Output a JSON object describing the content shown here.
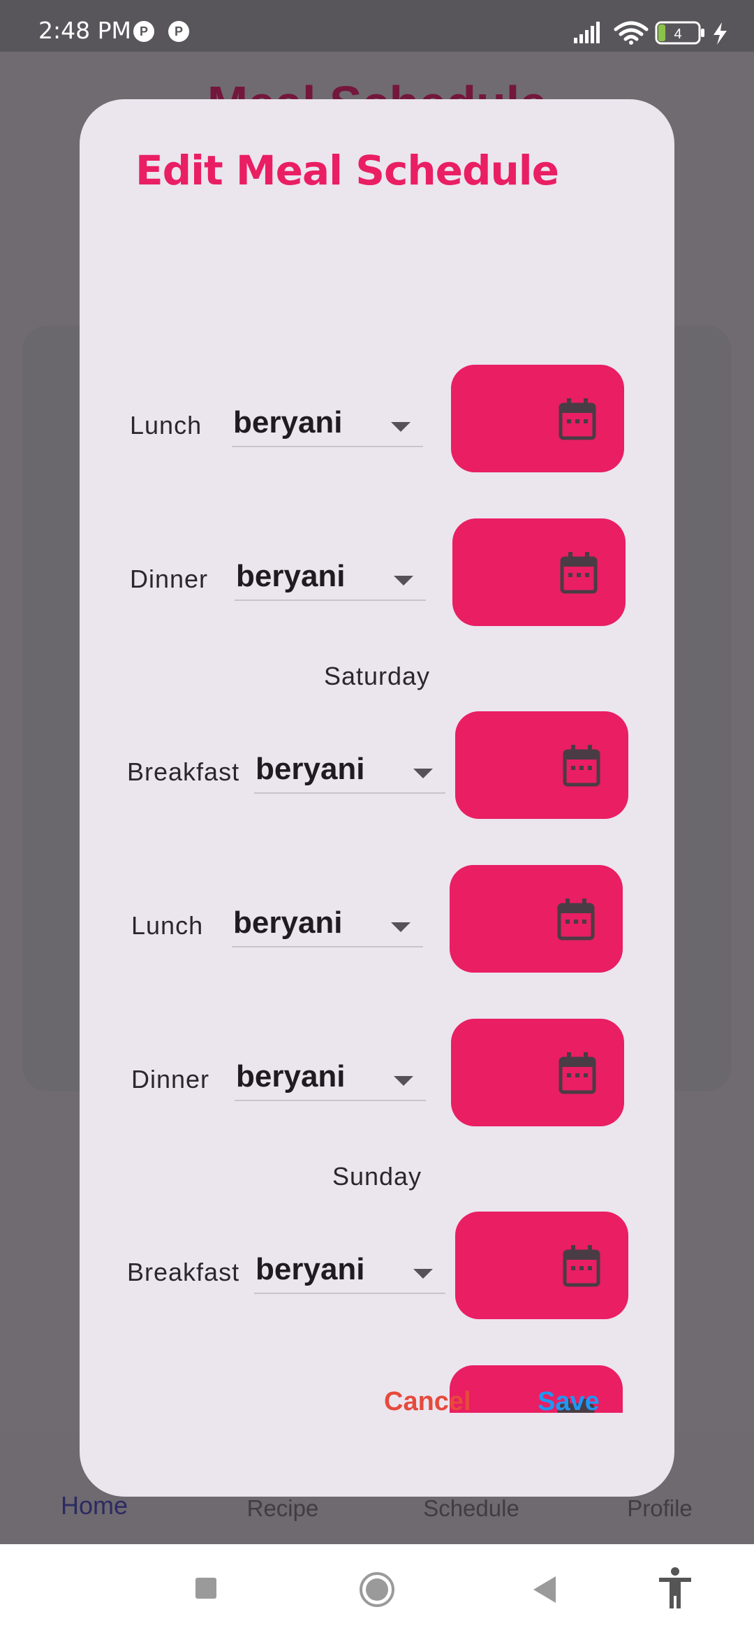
{
  "status_bar": {
    "time": "2:48 PM",
    "battery": "4"
  },
  "background": {
    "title": "Meal Schedule",
    "nav": [
      {
        "label": "Home"
      },
      {
        "label": "Recipe"
      },
      {
        "label": "Schedule"
      },
      {
        "label": "Profile"
      }
    ]
  },
  "dialog": {
    "title": "Edit Meal Schedule",
    "rows": [
      {
        "meal": "Lunch",
        "food": "beryani"
      },
      {
        "meal": "Dinner",
        "food": "beryani"
      },
      {
        "meal": "Breakfast",
        "food": "beryani"
      },
      {
        "meal": "Lunch",
        "food": "beryani"
      },
      {
        "meal": "Dinner",
        "food": "beryani"
      },
      {
        "meal": "Breakfast",
        "food": "beryani"
      }
    ],
    "days": [
      "Saturday",
      "Sunday"
    ],
    "cancel_label": "Cancel",
    "save_label": "Save"
  },
  "colors": {
    "accent": "#e91e63",
    "cancel": "#e64a3c",
    "save": "#2196f3"
  }
}
